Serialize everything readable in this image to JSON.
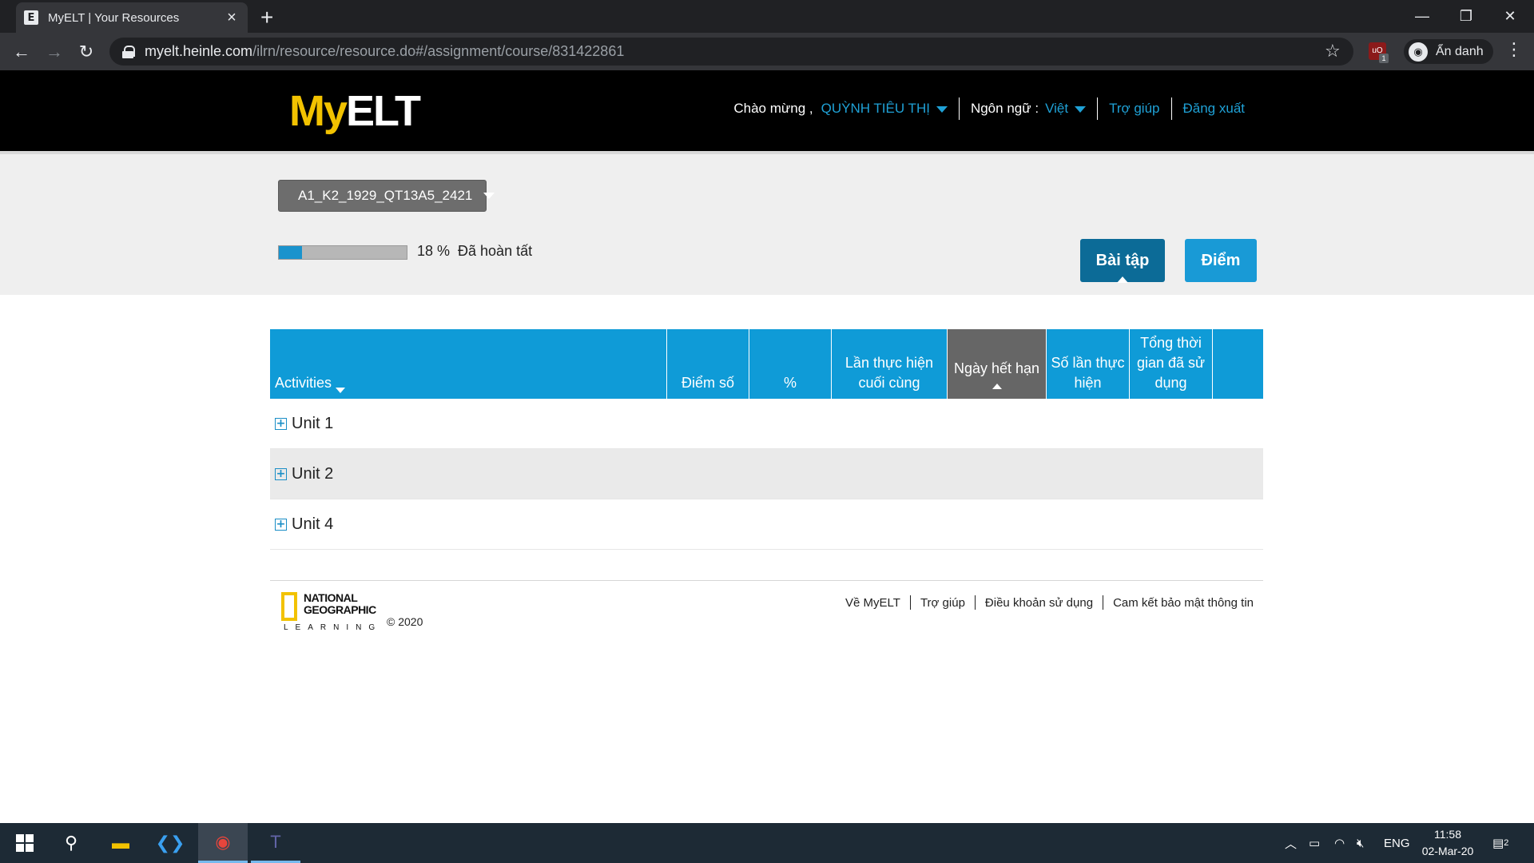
{
  "browser": {
    "tab_title": "MyELT | Your Resources",
    "tab_favicon": "E",
    "url_host": "myelt.heinle.com",
    "url_path": "/ilrn/resource/resource.do#/assignment/course/831422861",
    "extension_badge": "1",
    "extension_label": "uO",
    "incognito_label": "Ẩn danh"
  },
  "header": {
    "logo_my": "My",
    "logo_elt": "ELT",
    "welcome_label": "Chào mừng ,",
    "user_name": "QUỲNH TIÊU THỊ",
    "language_label": "Ngôn ngữ :",
    "language_value": "Việt",
    "help_link": "Trợ giúp",
    "logout_link": "Đăng xuất"
  },
  "course": {
    "selected": "A1_K2_1929_QT13A5_2421",
    "progress_percent": 18,
    "progress_text": "18 %  Đã hoàn tất",
    "tab_assignments": "Bài tập",
    "tab_grades": "Điểm"
  },
  "table": {
    "headers": {
      "activities": "Activities",
      "score": "Điểm số",
      "percent": "%",
      "last_attempt": "Lần thực hiện cuối cùng",
      "due_date": "Ngày hết hạn",
      "attempts": "Số lần thực hiện",
      "total_time": "Tổng thời gian đã sử dụng"
    },
    "rows": [
      {
        "label": "Unit 1"
      },
      {
        "label": "Unit 2"
      },
      {
        "label": "Unit 4"
      }
    ]
  },
  "footer": {
    "brand_line1": "NATIONAL",
    "brand_line2": "GEOGRAPHIC",
    "brand_line3": "LEARNING",
    "copyright": "© 2020",
    "links": [
      "Về MyELT",
      "Trợ giúp",
      "Điều khoản sử dụng",
      "Cam kết bảo mật thông tin"
    ]
  },
  "taskbar": {
    "language": "ENG",
    "time": "11:58",
    "date": "02-Mar-20",
    "notification_count": "2"
  },
  "colors": {
    "accent": "#0f9bd7",
    "header_bg": "#000000",
    "logo_yellow": "#f2c200",
    "active_tab": "#0c6b97"
  }
}
